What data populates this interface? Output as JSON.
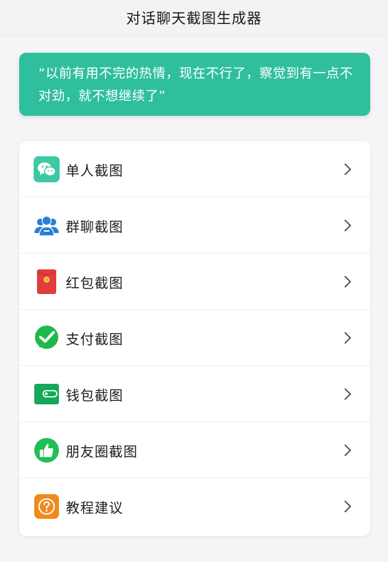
{
  "header": {
    "title": "对话聊天截图生成器"
  },
  "banner": {
    "quote": "“以前有用不完的热情，现在不行了，察觉到有一点不对劲，就不想继续了”",
    "color": "#2fbf9d"
  },
  "menu": {
    "items": [
      {
        "label": "单人截图",
        "icon": "wechat-chat-icon"
      },
      {
        "label": "群聊截图",
        "icon": "group-people-icon"
      },
      {
        "label": "红包截图",
        "icon": "red-envelope-icon"
      },
      {
        "label": "支付截图",
        "icon": "payment-check-icon"
      },
      {
        "label": "钱包截图",
        "icon": "wallet-icon"
      },
      {
        "label": "朋友圈截图",
        "icon": "moments-thumbs-up-icon"
      },
      {
        "label": "教程建议",
        "icon": "help-question-icon"
      }
    ]
  },
  "colors": {
    "wechat_green": "#3ec8a5",
    "group_blue": "#2a7fd4",
    "red_envelope": "#e23c3c",
    "pay_green": "#1eb94a",
    "wallet_green": "#14a85b",
    "moments_green": "#1fbf55",
    "help_orange": "#f08a1c"
  }
}
